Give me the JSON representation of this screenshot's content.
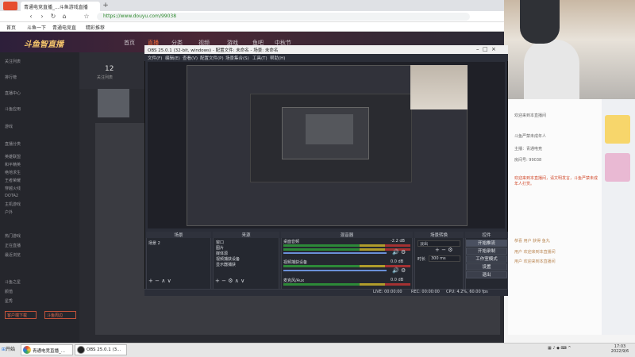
{
  "browser": {
    "tab_title": "青通电竞直播_...斗鱼游戏直播",
    "new_tab": "+",
    "url": "https://www.douyu.com/99038",
    "bookmarks": [
      "首页",
      "斗鱼一下",
      "青通电竞直",
      "精彩推荐"
    ],
    "nav_icons": [
      "back-icon",
      "forward-icon",
      "reload-icon",
      "home-icon",
      "star-icon"
    ]
  },
  "site": {
    "logo_text": "斗鱼智直播",
    "nav": [
      "首页",
      "直播",
      "分类",
      "视频",
      "游戏",
      "鱼吧",
      "中秋节"
    ],
    "sidebar": [
      "关注列表",
      "排行榜",
      "直播中心",
      "斗鱼应用",
      "游戏",
      "直播分类",
      "英雄联盟",
      "和平精英",
      "绝地求生",
      "王者荣耀",
      "穿越火线",
      "DOTA2",
      "主机游戏",
      "户外",
      "热门游戏",
      "正在直播",
      "最近浏览",
      "斗鱼之星",
      "颜值",
      "星秀"
    ],
    "sidebar_buttons": [
      "客户端下载",
      "斗鱼周边"
    ],
    "room_count": "12",
    "room_label": "关注列表"
  },
  "obs": {
    "title": "OBS 25.0.1 (32-bit, windows) - 配置文件: 未命名 - 场景: 未命名",
    "menu": [
      "文件(F)",
      "编辑(E)",
      "查看(V)",
      "配置文件(P)",
      "场景集合(S)",
      "工具(T)",
      "帮助(H)"
    ],
    "docks": {
      "scenes": {
        "title": "场景",
        "items": [
          "场景 2"
        ]
      },
      "sources": {
        "title": "来源",
        "items": [
          "窗口",
          "图片",
          "媒体源",
          "视频捕获设备",
          "显示器捕获"
        ]
      },
      "mixer": {
        "title": "混音器",
        "channels": [
          {
            "name": "桌面音频",
            "db": "-2.2 dB"
          },
          {
            "name": "视频捕获设备",
            "db": "0.0 dB"
          },
          {
            "name": "麦克风/Aux",
            "db": "0.0 dB"
          }
        ]
      },
      "transitions": {
        "title": "场景转换",
        "type": "淡出",
        "duration_label": "时长",
        "duration": "300 ms"
      },
      "controls": {
        "title": "控件",
        "buttons": [
          "开始推流",
          "开始录制",
          "工作室模式",
          "设置",
          "退出"
        ]
      }
    },
    "status": {
      "live": "LIVE: 00:00:00",
      "rec": "REC: 00:00:00",
      "cpu": "CPU: 4.2%, 60.00 fps"
    }
  },
  "chat": {
    "lines": [
      "欢迎来到本直播间",
      "斗鱼严禁未成年人",
      "主播：青通电竞",
      "房间号: 99038",
      "欢迎来到本直播间，请文明发言，斗鱼严禁未成年人打赏。",
      "恭喜 用户 获得 鱼丸",
      "用户 欢迎来到本直播间",
      "用户 欢迎来到本直播间"
    ]
  },
  "taskbar": {
    "start": "开始",
    "items": [
      {
        "label": "青通电竞直播_...",
        "color": "#2a7be4"
      },
      {
        "label": "OBS 25.0.1 (3...",
        "color": "#222"
      }
    ],
    "time": "17:03",
    "date": "2022/9/6"
  }
}
